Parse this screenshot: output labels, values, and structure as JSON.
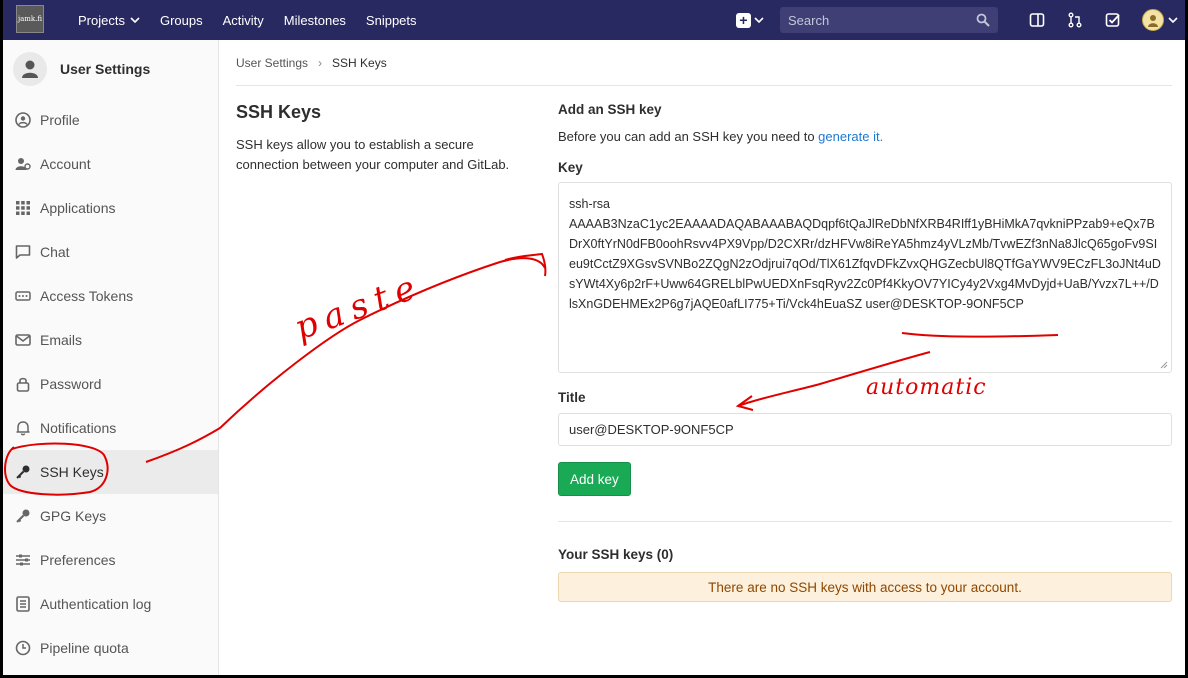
{
  "navbar": {
    "logo_text": "jamk.fi",
    "links": [
      {
        "label": "Projects",
        "has_dropdown": true
      },
      {
        "label": "Groups"
      },
      {
        "label": "Activity"
      },
      {
        "label": "Milestones"
      },
      {
        "label": "Snippets"
      }
    ],
    "search_placeholder": "Search"
  },
  "sidebar": {
    "title": "User Settings",
    "items": [
      {
        "label": "Profile",
        "icon": "profile-icon"
      },
      {
        "label": "Account",
        "icon": "account-icon"
      },
      {
        "label": "Applications",
        "icon": "applications-icon"
      },
      {
        "label": "Chat",
        "icon": "chat-icon"
      },
      {
        "label": "Access Tokens",
        "icon": "access-tokens-icon"
      },
      {
        "label": "Emails",
        "icon": "emails-icon"
      },
      {
        "label": "Password",
        "icon": "lock-icon"
      },
      {
        "label": "Notifications",
        "icon": "bell-icon"
      },
      {
        "label": "SSH Keys",
        "icon": "key-icon",
        "active": true
      },
      {
        "label": "GPG Keys",
        "icon": "key-icon"
      },
      {
        "label": "Preferences",
        "icon": "preferences-icon"
      },
      {
        "label": "Authentication log",
        "icon": "log-icon"
      },
      {
        "label": "Pipeline quota",
        "icon": "pipeline-icon"
      }
    ]
  },
  "breadcrumb": {
    "parent": "User Settings",
    "current": "SSH Keys"
  },
  "intro": {
    "title": "SSH Keys",
    "description": "SSH keys allow you to establish a secure connection between your computer and GitLab."
  },
  "form": {
    "heading": "Add an SSH key",
    "intro_text": "Before you can add an SSH key you need to ",
    "intro_link": "generate it.",
    "key_label": "Key",
    "key_value": "ssh-rsa\nAAAAB3NzaC1yc2EAAAADAQABAAABAQDqpf6tQaJlReDbNfXRB4RIff1yBHiMkA7qvkniPPzab9+eQx7BDrX0ftYrN0dFB0oohRsvv4PX9Vpp/D2CXRr/dzHFVw8iReYA5hmz4yVLzMb/TvwEZf3nNa8JlcQ65goFv9SIeu9tCctZ9XGsvSVNBo2ZQgN2zOdjrui7qOd/TlX61ZfqvDFkZvxQHGZecbUl8QTfGaYWV9ECzFL3oJNt4uDsYWt4Xy6p2rF+Uww64GRELblPwUEDXnFsqRyv2Zc0Pf4KkyOV7YICy4y2Vxg4MvDyjd+UaB/Yvzx7L++/DlsXnGDEHMEx2P6g7jAQE0afLI775+Ti/Vck4hEuaSZ user@DESKTOP-9ONF5CP",
    "title_label": "Title",
    "title_value": "user@DESKTOP-9ONF5CP",
    "submit_label": "Add key"
  },
  "keys_list": {
    "heading": "Your SSH keys (0)",
    "empty_message": "There are no SSH keys with access to your account."
  },
  "annotations": {
    "paste_label": "paste",
    "automatic_label": "automatic",
    "ink_color": "#e00000"
  }
}
